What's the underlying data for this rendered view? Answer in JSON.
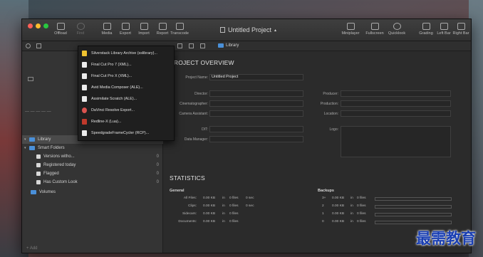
{
  "toolbar": {
    "left_buttons": [
      {
        "label": "Offload"
      },
      {
        "label": "Find"
      },
      {
        "label": "Media"
      },
      {
        "label": "Export"
      },
      {
        "label": "Import"
      },
      {
        "label": "Report"
      },
      {
        "label": "Transcode"
      }
    ],
    "right_buttons": [
      {
        "label": "Miniplayer"
      },
      {
        "label": "Fullscreen"
      },
      {
        "label": "Quicklook"
      },
      {
        "label": "Grading"
      },
      {
        "label": "Left Bar"
      },
      {
        "label": "Right Bar"
      }
    ],
    "title": "Untitled Project",
    "title_chevron": "▴"
  },
  "subbar": {
    "breadcrumb": "Library"
  },
  "export_menu": {
    "items": [
      {
        "label": "Silverstack Library Archive (sslibrary)..."
      },
      {
        "label": "Final Cut Pro 7 (XML)..."
      },
      {
        "label": "Final Cut Pro X (XML)..."
      },
      {
        "label": "Avid Media Composer (ALE)..."
      },
      {
        "label": "Assimilate Scratch (ALE)..."
      },
      {
        "label": "DaVinci Resolve Export..."
      },
      {
        "label": "Redline-X (Lua)..."
      },
      {
        "label": "SpeedgradeFrameCycler (RCP)..."
      }
    ]
  },
  "sidebar": {
    "items": [
      {
        "label": "Library",
        "count": ""
      },
      {
        "label": "Smart Folders",
        "count": ""
      },
      {
        "label": "Versions witho...",
        "count": "0"
      },
      {
        "label": "Registered today",
        "count": "0"
      },
      {
        "label": "Flagged",
        "count": "0"
      },
      {
        "label": "Has Custom Look",
        "count": "0"
      },
      {
        "label": "Volumes",
        "count": ""
      }
    ],
    "add_label": "+ Add"
  },
  "overview": {
    "heading": "PROJECT OVERVIEW",
    "fields_left": [
      {
        "label": "Project Name:",
        "value": "Untitled Project"
      },
      {
        "label": "Director:",
        "value": ""
      },
      {
        "label": "Cinematographer:",
        "value": ""
      },
      {
        "label": "Camera Assistant:",
        "value": ""
      },
      {
        "label": "DIT:",
        "value": ""
      },
      {
        "label": "Data Manager:",
        "value": ""
      }
    ],
    "fields_right": [
      {
        "label": "Producer:",
        "value": ""
      },
      {
        "label": "Production:",
        "value": ""
      },
      {
        "label": "Location:",
        "value": ""
      },
      {
        "label": "Logo:",
        "value": ""
      }
    ]
  },
  "statistics": {
    "heading": "STATISTICS",
    "general_heading": "General",
    "general_rows": [
      {
        "label": "All Files:",
        "size": "0.00 KB",
        "in": "in",
        "files": "0 files",
        "dur": "0 sec"
      },
      {
        "label": "Clips:",
        "size": "0.00 KB",
        "in": "in",
        "files": "0 files",
        "dur": "0 sec"
      },
      {
        "label": "Sidecars:",
        "size": "0.00 KB",
        "in": "in",
        "files": "0 files",
        "dur": ""
      },
      {
        "label": "Documents:",
        "size": "0.00 KB",
        "in": "in",
        "files": "0 files",
        "dur": ""
      }
    ],
    "backups_heading": "Backups",
    "backup_rows": [
      {
        "label": "3+",
        "size": "0.00 KB",
        "in": "in",
        "files": "0 files",
        "progress": 0
      },
      {
        "label": "2",
        "size": "0.00 KB",
        "in": "in",
        "files": "0 files",
        "progress": 0
      },
      {
        "label": "1",
        "size": "0.00 KB",
        "in": "in",
        "files": "0 files",
        "progress": 0
      },
      {
        "label": "0",
        "size": "0.00 KB",
        "in": "in",
        "files": "0 files",
        "progress": 0
      }
    ]
  },
  "watermark": "最需教育",
  "colors": {
    "folder_blue": "#4a90d9",
    "traffic_red": "#fc5f57",
    "traffic_yellow": "#fdbc2e",
    "traffic_green": "#28c840"
  }
}
